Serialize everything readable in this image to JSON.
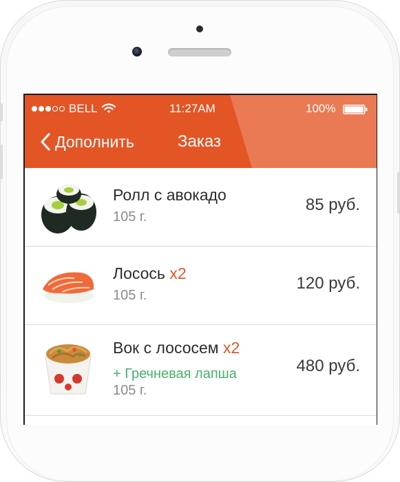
{
  "colors": {
    "accent": "#e45525",
    "extra_green": "#48b06a"
  },
  "status_bar": {
    "carrier": "BELL",
    "time": "11:27AM",
    "battery": "100%",
    "signal_icon": "signal-dots-icon",
    "wifi_icon": "wifi-icon",
    "battery_icon": "battery-icon"
  },
  "nav": {
    "back_label": "Дополнить",
    "back_icon": "chevron-left-icon",
    "title": "Заказ"
  },
  "items": [
    {
      "name": "Ролл с авокадо",
      "qty": "",
      "extra": "",
      "weight": "105 г.",
      "price": "85 руб.",
      "image": "avocado-roll-icon"
    },
    {
      "name": "Лосось",
      "qty": "x2",
      "extra": "",
      "weight": "105 г.",
      "price": "120 руб.",
      "image": "salmon-nigiri-icon"
    },
    {
      "name": "Вок с лососем",
      "qty": "x2",
      "extra": "+ Гречневая лапша",
      "weight": "105 г.",
      "price": "480 руб.",
      "image": "wok-box-icon"
    }
  ]
}
